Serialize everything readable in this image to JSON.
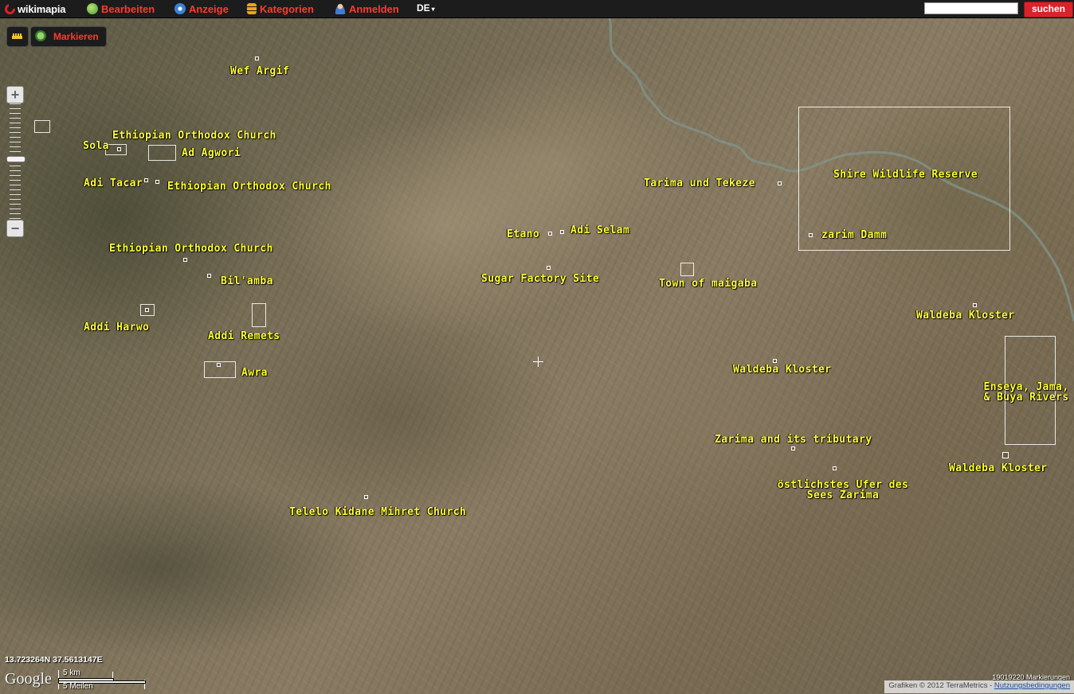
{
  "app": {
    "logo_text": "wikimapia",
    "menu": [
      {
        "label": "Bearbeiten",
        "icon": "edit-globe-icon"
      },
      {
        "label": "Anzeige",
        "icon": "compass-icon"
      },
      {
        "label": "Kategorien",
        "icon": "categories-icon"
      },
      {
        "label": "Anmelden",
        "icon": "user-icon"
      }
    ],
    "language": "DE",
    "search": {
      "value": "",
      "placeholder": ""
    },
    "search_button": "suchen"
  },
  "tools": {
    "ruler_icon": "ruler-icon",
    "mark_label": "Markieren"
  },
  "map": {
    "type": "satellite",
    "labels": [
      {
        "text": "Wef Argif"
      },
      {
        "text": "Ethiopian Orthodox Church"
      },
      {
        "text": "Sola"
      },
      {
        "text": "Ad Agwori"
      },
      {
        "text": "Adi Tacar"
      },
      {
        "text": "Ethiopian Orthodox Church"
      },
      {
        "text": "Ethiopian Orthodox Church"
      },
      {
        "text": "Bil'amba"
      },
      {
        "text": "Addi Harwo"
      },
      {
        "text": "Addi Remets"
      },
      {
        "text": "Awra"
      },
      {
        "text": "Telelo Kidane Mihret Church"
      },
      {
        "text": "Etano"
      },
      {
        "text": "Adi Selam"
      },
      {
        "text": "Sugar Factory Site"
      },
      {
        "text": "Tarima und Tekeze"
      },
      {
        "text": "Town of maigaba"
      },
      {
        "text": "Shire Wildlife Reserve"
      },
      {
        "text": "zarim Damm"
      },
      {
        "text": "Waldeba Kloster"
      },
      {
        "text": "Waldeba Kloster"
      },
      {
        "text": "Enseya, Jama,\n& Buya Rivers"
      },
      {
        "text": "Zarima and its tributary"
      },
      {
        "text": "Waldeba Kloster"
      },
      {
        "text": "östlichstes Ufer des\nSees Zarima"
      }
    ],
    "coordinates": "13.723264N 37.5613147E",
    "scale": {
      "metric": "5 km",
      "imperial": "5 Meilen"
    },
    "google_logo": "Google",
    "markings_count": "19019220 Markierungen",
    "attribution": "Grafiken © 2012 TerraMetrics - ",
    "terms_link": "Nutzungsbedingungen"
  }
}
